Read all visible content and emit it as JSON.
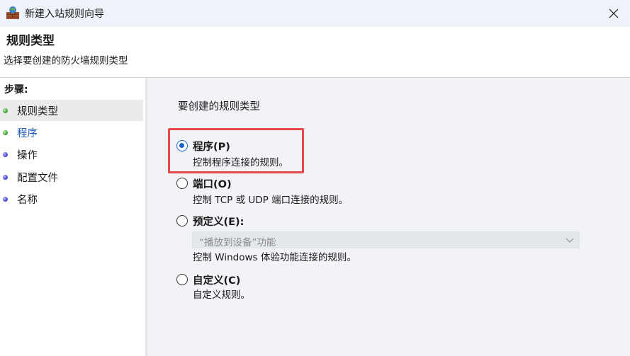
{
  "window": {
    "title": "新建入站规则向导",
    "app_icon": "firewall-wall-icon",
    "close_icon": "close-icon"
  },
  "header": {
    "title": "规则类型",
    "subtitle": "选择要创建的防火墙规则类型"
  },
  "sidebar": {
    "steps_title": "步骤:",
    "items": [
      {
        "label": "规则类型",
        "dot": "green",
        "active": true
      },
      {
        "label": "程序",
        "dot": "green",
        "link": true
      },
      {
        "label": "操作",
        "dot": "blue"
      },
      {
        "label": "配置文件",
        "dot": "blue"
      },
      {
        "label": "名称",
        "dot": "blue"
      }
    ]
  },
  "main": {
    "heading": "要创建的规则类型",
    "options": [
      {
        "label": "程序(P)",
        "description": "控制程序连接的规则。",
        "checked": true
      },
      {
        "label": "端口(O)",
        "description": "控制 TCP 或 UDP 端口连接的规则。",
        "checked": false
      },
      {
        "label": "预定义(E):",
        "description": "控制 Windows 体验功能连接的规则。",
        "checked": false,
        "select_value": "“播放到设备”功能",
        "select_disabled": true
      },
      {
        "label": "自定义(C)",
        "description": "自定义规则。",
        "checked": false
      }
    ]
  },
  "colors": {
    "highlight": "#e8474b",
    "accent": "#1363c6",
    "link": "#1f5fb8"
  }
}
